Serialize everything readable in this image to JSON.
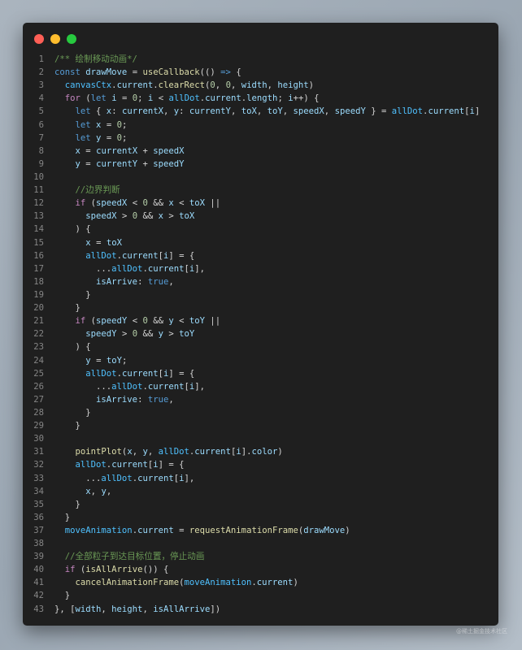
{
  "window": {
    "controls": [
      {
        "name": "close",
        "color": "#ff5f56"
      },
      {
        "name": "minimize",
        "color": "#ffbd2e"
      },
      {
        "name": "maximize",
        "color": "#27c93f"
      }
    ]
  },
  "code": {
    "lines": [
      "/** 绘制移动动画*/",
      "const drawMove = useCallback(() => {",
      "  canvasCtx.current.clearRect(0, 0, width, height)",
      "  for (let i = 0; i < allDot.current.length; i++) {",
      "    let { x: currentX, y: currentY, toX, toY, speedX, speedY } = allDot.current[i]",
      "    let x = 0;",
      "    let y = 0;",
      "    x = currentX + speedX",
      "    y = currentY + speedY",
      "",
      "    //边界判断",
      "    if (speedX < 0 && x < toX ||",
      "      speedX > 0 && x > toX",
      "    ) {",
      "      x = toX",
      "      allDot.current[i] = {",
      "        ...allDot.current[i],",
      "        isArrive: true,",
      "      }",
      "    }",
      "    if (speedY < 0 && y < toY ||",
      "      speedY > 0 && y > toY",
      "    ) {",
      "      y = toY;",
      "      allDot.current[i] = {",
      "        ...allDot.current[i],",
      "        isArrive: true,",
      "      }",
      "    }",
      "",
      "    pointPlot(x, y, allDot.current[i].color)",
      "    allDot.current[i] = {",
      "      ...allDot.current[i],",
      "      x, y,",
      "    }",
      "  }",
      "  moveAnimation.current = requestAnimationFrame(drawMove)",
      "",
      "  //全部粒子到达目标位置，停止动画",
      "  if (isAllArrive()) {",
      "    cancelAnimationFrame(moveAnimation.current)",
      "  }",
      "}, [width, height, isAllArrive])"
    ]
  },
  "watermark": "@稀土掘金技术社区"
}
